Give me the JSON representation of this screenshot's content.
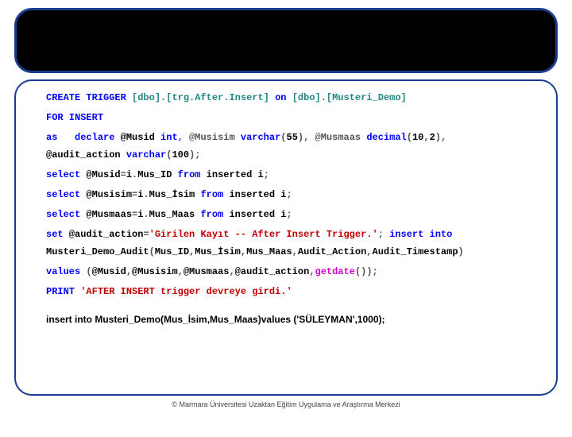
{
  "footer": "© Marmara Üniversitesi Uzaktan Eğitim Uygulama ve Araştırma Merkezi",
  "code": {
    "l1": {
      "a": "CREATE",
      "b": " TRIGGER ",
      "c": "[dbo]",
      "d": ".",
      "e": "[trg.After.Insert]",
      "f": " on ",
      "g": "[dbo]",
      "h": ".",
      "i": "[Musteri_Demo]"
    },
    "l2": {
      "a": "FOR",
      "b": " INSERT"
    },
    "l3": {
      "a": "as",
      "b": "   ",
      "c": "declare",
      "d": " @Musid ",
      "e": "int",
      "f": ", @Musisim ",
      "g": "varchar",
      "h": "(",
      "i": "55",
      "j": "), @Musmaas ",
      "k": "decimal",
      "l": "(",
      "m": "10",
      "n": ",",
      "o": "2",
      "p": "),"
    },
    "l3b": {
      "a": "@audit_action ",
      "b": "varchar",
      "c": "(",
      "d": "100",
      "e": ");"
    },
    "l4": {
      "a": "select",
      "b": " @Musid",
      "c": "=",
      "d": "i",
      "e": ".",
      "f": "Mus_ID ",
      "g": "from",
      "h": " inserted i",
      "i": ";"
    },
    "l5": {
      "a": "select",
      "b": " @Musisim",
      "c": "=",
      "d": "i",
      "e": ".",
      "f": "Mus_İsim ",
      "g": "from",
      "h": " inserted i",
      "i": ";"
    },
    "l6": {
      "a": "select",
      "b": " @Musmaas",
      "c": "=",
      "d": "i",
      "e": ".",
      "f": "Mus_Maas ",
      "g": "from",
      "h": " inserted i",
      "i": ";"
    },
    "l7": {
      "a": "set",
      "b": " @audit_action",
      "c": "=",
      "d": "'Girilen Kayıt -- After Insert Trigger.'",
      "e": "; ",
      "f": "insert",
      "g": " into"
    },
    "l7b": {
      "a": "Musteri_Demo_Audit",
      "b": "(",
      "c": "Mus_ID",
      "d": ",",
      "e": "Mus_İsim",
      "f": ",",
      "g": "Mus_Maas",
      "h": ",",
      "i": "Audit_Action",
      "j": ",",
      "k": "Audit_Timestamp",
      "l": ")"
    },
    "l8": {
      "a": "values",
      "b": " (",
      "c": "@Musid",
      "d": ",",
      "e": "@Musisim",
      "f": ",",
      "g": "@Musmaas",
      "h": ",",
      "i": "@audit_action",
      "j": ",",
      "k": "getdate",
      "l": "());"
    },
    "l9": {
      "a": "PRINT",
      "b": " ",
      "c": "'AFTER INSERT trigger devreye girdi.'"
    },
    "insert": "insert into Musteri_Demo(Mus_İsim,Mus_Maas)values ('SÜLEYMAN',1000);"
  }
}
